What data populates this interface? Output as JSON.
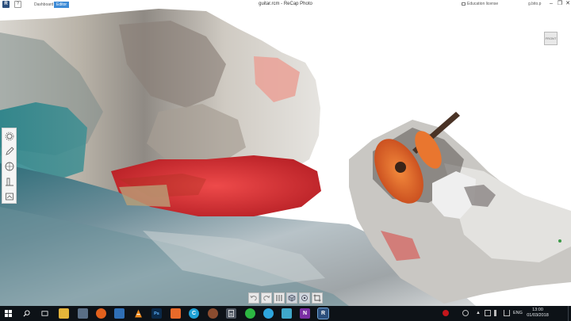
{
  "titlebar": {
    "logo": "R",
    "help": "?",
    "tabs": [
      {
        "label": "Dashboard",
        "active": false
      },
      {
        "label": "Editor",
        "active": true
      }
    ],
    "title": "guitar.rcm - ReCap Photo",
    "license": "Education license",
    "user": "g.bito.p"
  },
  "viewcube": {
    "label": "FRONT"
  },
  "left_toolbar": {
    "tools": [
      "gear-icon",
      "pencil-icon",
      "sphere-icon",
      "measure-icon",
      "frame-icon"
    ]
  },
  "bottom_toolbar": {
    "tools": [
      "undo-icon",
      "redo-icon",
      "slice-icon",
      "cube-icon",
      "target-icon",
      "crop-icon"
    ]
  },
  "taskbar": {
    "apps": [
      "windows-icon",
      "search-icon",
      "task-view-icon",
      "file-explorer-icon",
      "app-icon",
      "firefox-icon",
      "app-icon",
      "vlc-icon",
      "photoshop-icon",
      "app-icon",
      "ccleaner-icon",
      "app-icon",
      "calculator-icon",
      "whatsapp-icon",
      "telegram-icon",
      "app-icon",
      "onenote-icon",
      "recap-icon"
    ],
    "tray_language": "ENG",
    "clock_time": "13:00",
    "clock_date": "01/03/2018"
  },
  "colors": {
    "accent": "#3d8bd6",
    "taskbar": "#0d1217",
    "guitar_orange": "#e8652a",
    "red_surface": "#d93236"
  }
}
